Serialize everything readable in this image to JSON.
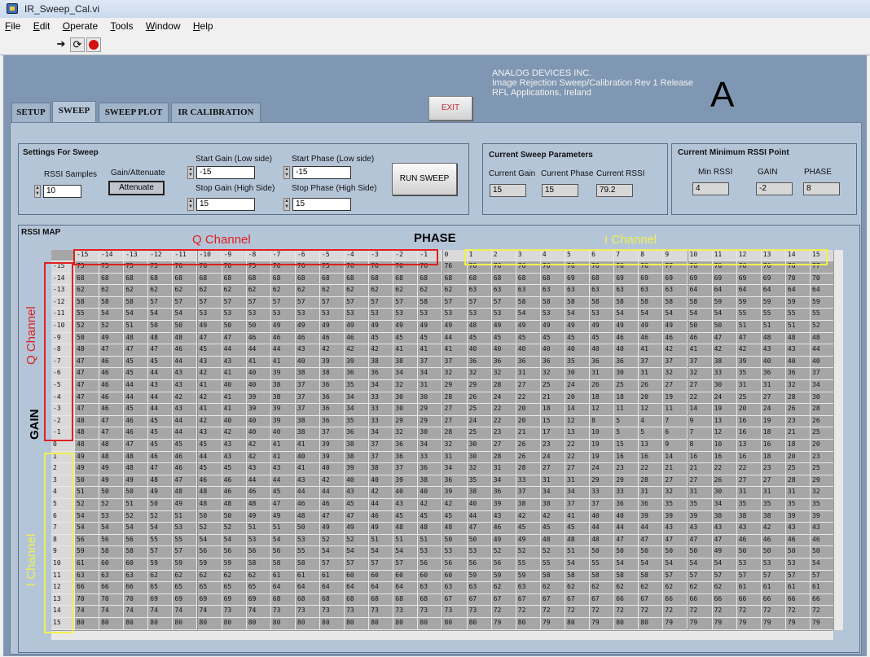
{
  "window": {
    "title": "IR_Sweep_Cal.vi"
  },
  "menu": [
    "File",
    "Edit",
    "Operate",
    "Tools",
    "Window",
    "Help"
  ],
  "header": {
    "company": "ANALOG DEVICES INC.",
    "release": "Image Rejection Sweep/Calibration Rev 1 Release",
    "location": "RFL Applications, Ireland",
    "big_letter": "A",
    "exit_label": "EXIT"
  },
  "tabs": [
    "SETUP",
    "SWEEP",
    "SWEEP PLOT",
    "IR CALIBRATION"
  ],
  "settings": {
    "title": "Settings For Sweep",
    "rssi_samples_label": "RSSI Samples",
    "rssi_samples": "10",
    "gain_att_label": "Gain/Attenuate",
    "gain_att_value": "Attenuate",
    "start_gain_label": "Start Gain (Low side)",
    "start_gain": "-15",
    "stop_gain_label": "Stop Gain (High Side)",
    "stop_gain": "15",
    "start_phase_label": "Start Phase (Low side)",
    "start_phase": "-15",
    "stop_phase_label": "Stop Phase (High Side)",
    "stop_phase": "15",
    "run_label": "RUN SWEEP"
  },
  "current": {
    "title": "Current Sweep Parameters",
    "gain_label": "Current Gain",
    "phase_label": "Current Phase",
    "rssi_label": "Current RSSI",
    "gain": "15",
    "phase": "15",
    "rssi": "79.2"
  },
  "minimum": {
    "title": "Current Minimum RSSI Point",
    "rssi_label": "Min RSSI",
    "gain_label": "GAIN",
    "phase_label": "PHASE",
    "rssi": "4",
    "gain": "-2",
    "phase": "8"
  },
  "rssi_map": {
    "title": "RSSI MAP",
    "phase_label": "PHASE",
    "gain_label": "GAIN",
    "q_channel_label": "Q Channel",
    "i_channel_label": "I Channel",
    "columns": [
      -15,
      -14,
      -13,
      -12,
      -11,
      -10,
      -9,
      -8,
      -7,
      -6,
      -5,
      -4,
      -3,
      -2,
      -1,
      0,
      1,
      2,
      3,
      4,
      5,
      6,
      7,
      8,
      9,
      10,
      11,
      12,
      13,
      14,
      15
    ],
    "rows": [
      -15,
      -14,
      -13,
      -12,
      -11,
      -10,
      -9,
      -8,
      -7,
      -6,
      -5,
      -4,
      -3,
      -2,
      -1,
      0,
      1,
      2,
      3,
      4,
      5,
      6,
      7,
      8,
      9,
      10,
      11,
      12,
      13,
      14,
      15
    ],
    "values": [
      [
        75,
        75,
        75,
        75,
        76,
        76,
        76,
        75,
        76,
        76,
        75,
        76,
        76,
        76,
        76,
        76,
        76,
        76,
        76,
        76,
        76,
        76,
        76,
        76,
        77,
        76,
        76,
        76,
        76,
        76,
        77
      ],
      [
        68,
        68,
        68,
        68,
        68,
        68,
        68,
        68,
        68,
        68,
        68,
        68,
        68,
        68,
        68,
        68,
        68,
        68,
        68,
        68,
        69,
        68,
        69,
        69,
        69,
        69,
        69,
        69,
        69,
        70,
        70
      ],
      [
        62,
        62,
        62,
        62,
        62,
        62,
        62,
        62,
        62,
        62,
        62,
        62,
        62,
        62,
        62,
        62,
        63,
        63,
        63,
        63,
        63,
        63,
        63,
        63,
        63,
        64,
        64,
        64,
        64,
        64,
        64
      ],
      [
        58,
        58,
        58,
        57,
        57,
        57,
        57,
        57,
        57,
        57,
        57,
        57,
        57,
        57,
        58,
        57,
        57,
        57,
        58,
        58,
        58,
        58,
        58,
        58,
        58,
        58,
        59,
        59,
        59,
        59,
        59
      ],
      [
        55,
        54,
        54,
        54,
        54,
        53,
        53,
        53,
        53,
        53,
        53,
        53,
        53,
        53,
        53,
        53,
        53,
        53,
        54,
        53,
        54,
        53,
        54,
        54,
        54,
        54,
        54,
        55,
        55,
        55,
        55
      ],
      [
        52,
        52,
        51,
        50,
        50,
        49,
        50,
        50,
        49,
        49,
        49,
        49,
        49,
        49,
        49,
        49,
        48,
        49,
        49,
        49,
        49,
        49,
        49,
        49,
        49,
        50,
        50,
        51,
        51,
        51,
        52
      ],
      [
        50,
        49,
        48,
        48,
        48,
        47,
        47,
        46,
        46,
        46,
        46,
        46,
        45,
        45,
        45,
        44,
        45,
        45,
        45,
        45,
        45,
        45,
        46,
        46,
        46,
        46,
        47,
        47,
        48,
        48,
        48
      ],
      [
        48,
        47,
        47,
        47,
        46,
        45,
        44,
        44,
        44,
        43,
        42,
        42,
        42,
        41,
        41,
        41,
        40,
        40,
        40,
        40,
        40,
        40,
        40,
        41,
        42,
        41,
        42,
        42,
        43,
        43,
        44
      ],
      [
        47,
        46,
        45,
        45,
        44,
        43,
        43,
        41,
        41,
        40,
        39,
        39,
        38,
        38,
        37,
        37,
        36,
        36,
        36,
        36,
        35,
        36,
        36,
        37,
        37,
        37,
        38,
        39,
        40,
        40,
        40
      ],
      [
        47,
        46,
        45,
        44,
        43,
        42,
        41,
        40,
        39,
        38,
        38,
        36,
        36,
        34,
        34,
        32,
        32,
        32,
        31,
        32,
        30,
        31,
        30,
        31,
        32,
        32,
        33,
        35,
        36,
        36,
        37
      ],
      [
        47,
        46,
        44,
        43,
        43,
        41,
        40,
        40,
        38,
        37,
        36,
        35,
        34,
        32,
        31,
        29,
        29,
        28,
        27,
        25,
        24,
        26,
        25,
        26,
        27,
        27,
        30,
        31,
        31,
        32,
        34
      ],
      [
        47,
        46,
        44,
        44,
        42,
        42,
        41,
        39,
        38,
        37,
        36,
        34,
        33,
        30,
        30,
        28,
        26,
        24,
        22,
        21,
        20,
        18,
        18,
        20,
        19,
        22,
        24,
        25,
        27,
        28,
        30
      ],
      [
        47,
        46,
        45,
        44,
        43,
        41,
        41,
        39,
        39,
        37,
        36,
        34,
        33,
        30,
        29,
        27,
        25,
        22,
        20,
        18,
        14,
        12,
        11,
        12,
        11,
        14,
        19,
        20,
        24,
        26,
        28
      ],
      [
        48,
        47,
        46,
        45,
        44,
        42,
        40,
        40,
        39,
        38,
        36,
        35,
        33,
        29,
        29,
        27,
        24,
        22,
        20,
        15,
        12,
        8,
        5,
        4,
        7,
        9,
        13,
        16,
        19,
        23,
        26
      ],
      [
        48,
        47,
        46,
        45,
        44,
        43,
        42,
        40,
        40,
        38,
        37,
        36,
        34,
        32,
        30,
        28,
        25,
        23,
        21,
        17,
        13,
        10,
        5,
        5,
        6,
        7,
        12,
        16,
        18,
        21,
        25
      ],
      [
        48,
        48,
        47,
        45,
        45,
        45,
        43,
        42,
        41,
        41,
        39,
        38,
        37,
        36,
        34,
        32,
        30,
        27,
        26,
        23,
        22,
        19,
        15,
        13,
        9,
        8,
        10,
        13,
        16,
        18,
        20
      ],
      [
        49,
        48,
        48,
        46,
        46,
        44,
        43,
        42,
        41,
        40,
        39,
        38,
        37,
        36,
        33,
        31,
        30,
        28,
        26,
        24,
        22,
        19,
        16,
        16,
        14,
        16,
        16,
        16,
        18,
        20,
        23
      ],
      [
        49,
        49,
        48,
        47,
        46,
        45,
        45,
        43,
        43,
        41,
        40,
        39,
        38,
        37,
        36,
        34,
        32,
        31,
        28,
        27,
        27,
        24,
        23,
        22,
        21,
        21,
        22,
        22,
        23,
        25,
        25
      ],
      [
        50,
        49,
        49,
        48,
        47,
        46,
        46,
        44,
        44,
        43,
        42,
        40,
        40,
        39,
        38,
        36,
        35,
        34,
        33,
        31,
        31,
        29,
        29,
        28,
        27,
        27,
        26,
        27,
        27,
        28,
        29
      ],
      [
        51,
        50,
        50,
        49,
        48,
        48,
        46,
        46,
        45,
        44,
        44,
        43,
        42,
        40,
        40,
        39,
        38,
        36,
        37,
        34,
        34,
        33,
        33,
        31,
        32,
        31,
        30,
        31,
        31,
        31,
        32
      ],
      [
        52,
        52,
        51,
        50,
        49,
        48,
        48,
        48,
        47,
        46,
        46,
        45,
        44,
        43,
        42,
        42,
        40,
        39,
        38,
        38,
        37,
        37,
        36,
        36,
        35,
        35,
        34,
        35,
        35,
        35,
        35
      ],
      [
        54,
        53,
        52,
        52,
        51,
        50,
        50,
        49,
        49,
        48,
        47,
        47,
        46,
        45,
        45,
        45,
        44,
        43,
        42,
        42,
        41,
        40,
        40,
        39,
        39,
        39,
        38,
        38,
        38,
        39,
        39
      ],
      [
        54,
        54,
        54,
        54,
        53,
        52,
        52,
        51,
        51,
        50,
        49,
        49,
        49,
        48,
        48,
        48,
        47,
        46,
        45,
        45,
        45,
        44,
        44,
        44,
        43,
        43,
        43,
        43,
        42,
        43,
        43
      ],
      [
        56,
        56,
        56,
        55,
        55,
        54,
        54,
        53,
        54,
        53,
        52,
        52,
        51,
        51,
        51,
        50,
        50,
        49,
        49,
        48,
        48,
        48,
        47,
        47,
        47,
        47,
        47,
        46,
        46,
        46,
        46
      ],
      [
        59,
        58,
        58,
        57,
        57,
        56,
        56,
        56,
        56,
        55,
        54,
        54,
        54,
        54,
        53,
        53,
        53,
        52,
        52,
        52,
        51,
        50,
        50,
        50,
        50,
        50,
        49,
        50,
        50,
        50,
        50
      ],
      [
        61,
        60,
        60,
        59,
        59,
        59,
        59,
        58,
        58,
        58,
        57,
        57,
        57,
        57,
        56,
        56,
        56,
        56,
        55,
        55,
        54,
        55,
        54,
        54,
        54,
        54,
        54,
        53,
        53,
        53,
        54
      ],
      [
        63,
        63,
        63,
        62,
        62,
        62,
        62,
        62,
        61,
        61,
        61,
        60,
        60,
        60,
        60,
        60,
        59,
        59,
        59,
        58,
        58,
        58,
        58,
        58,
        57,
        57,
        57,
        57,
        57,
        57,
        57
      ],
      [
        66,
        66,
        66,
        65,
        65,
        65,
        65,
        65,
        64,
        64,
        64,
        64,
        64,
        64,
        63,
        63,
        63,
        62,
        63,
        62,
        62,
        62,
        62,
        62,
        62,
        62,
        62,
        61,
        61,
        61,
        61
      ],
      [
        70,
        70,
        70,
        69,
        69,
        69,
        69,
        69,
        68,
        68,
        68,
        68,
        68,
        68,
        68,
        67,
        67,
        67,
        67,
        67,
        67,
        67,
        66,
        67,
        66,
        66,
        66,
        66,
        66,
        66,
        66
      ],
      [
        74,
        74,
        74,
        74,
        74,
        74,
        73,
        74,
        73,
        73,
        73,
        73,
        73,
        73,
        73,
        73,
        73,
        72,
        72,
        72,
        72,
        72,
        72,
        72,
        72,
        72,
        72,
        72,
        72,
        72,
        72
      ],
      [
        80,
        80,
        80,
        80,
        80,
        80,
        80,
        80,
        80,
        80,
        80,
        80,
        80,
        80,
        80,
        80,
        80,
        79,
        80,
        79,
        80,
        79,
        80,
        80,
        79,
        79,
        79,
        79,
        79,
        79,
        79
      ]
    ]
  }
}
